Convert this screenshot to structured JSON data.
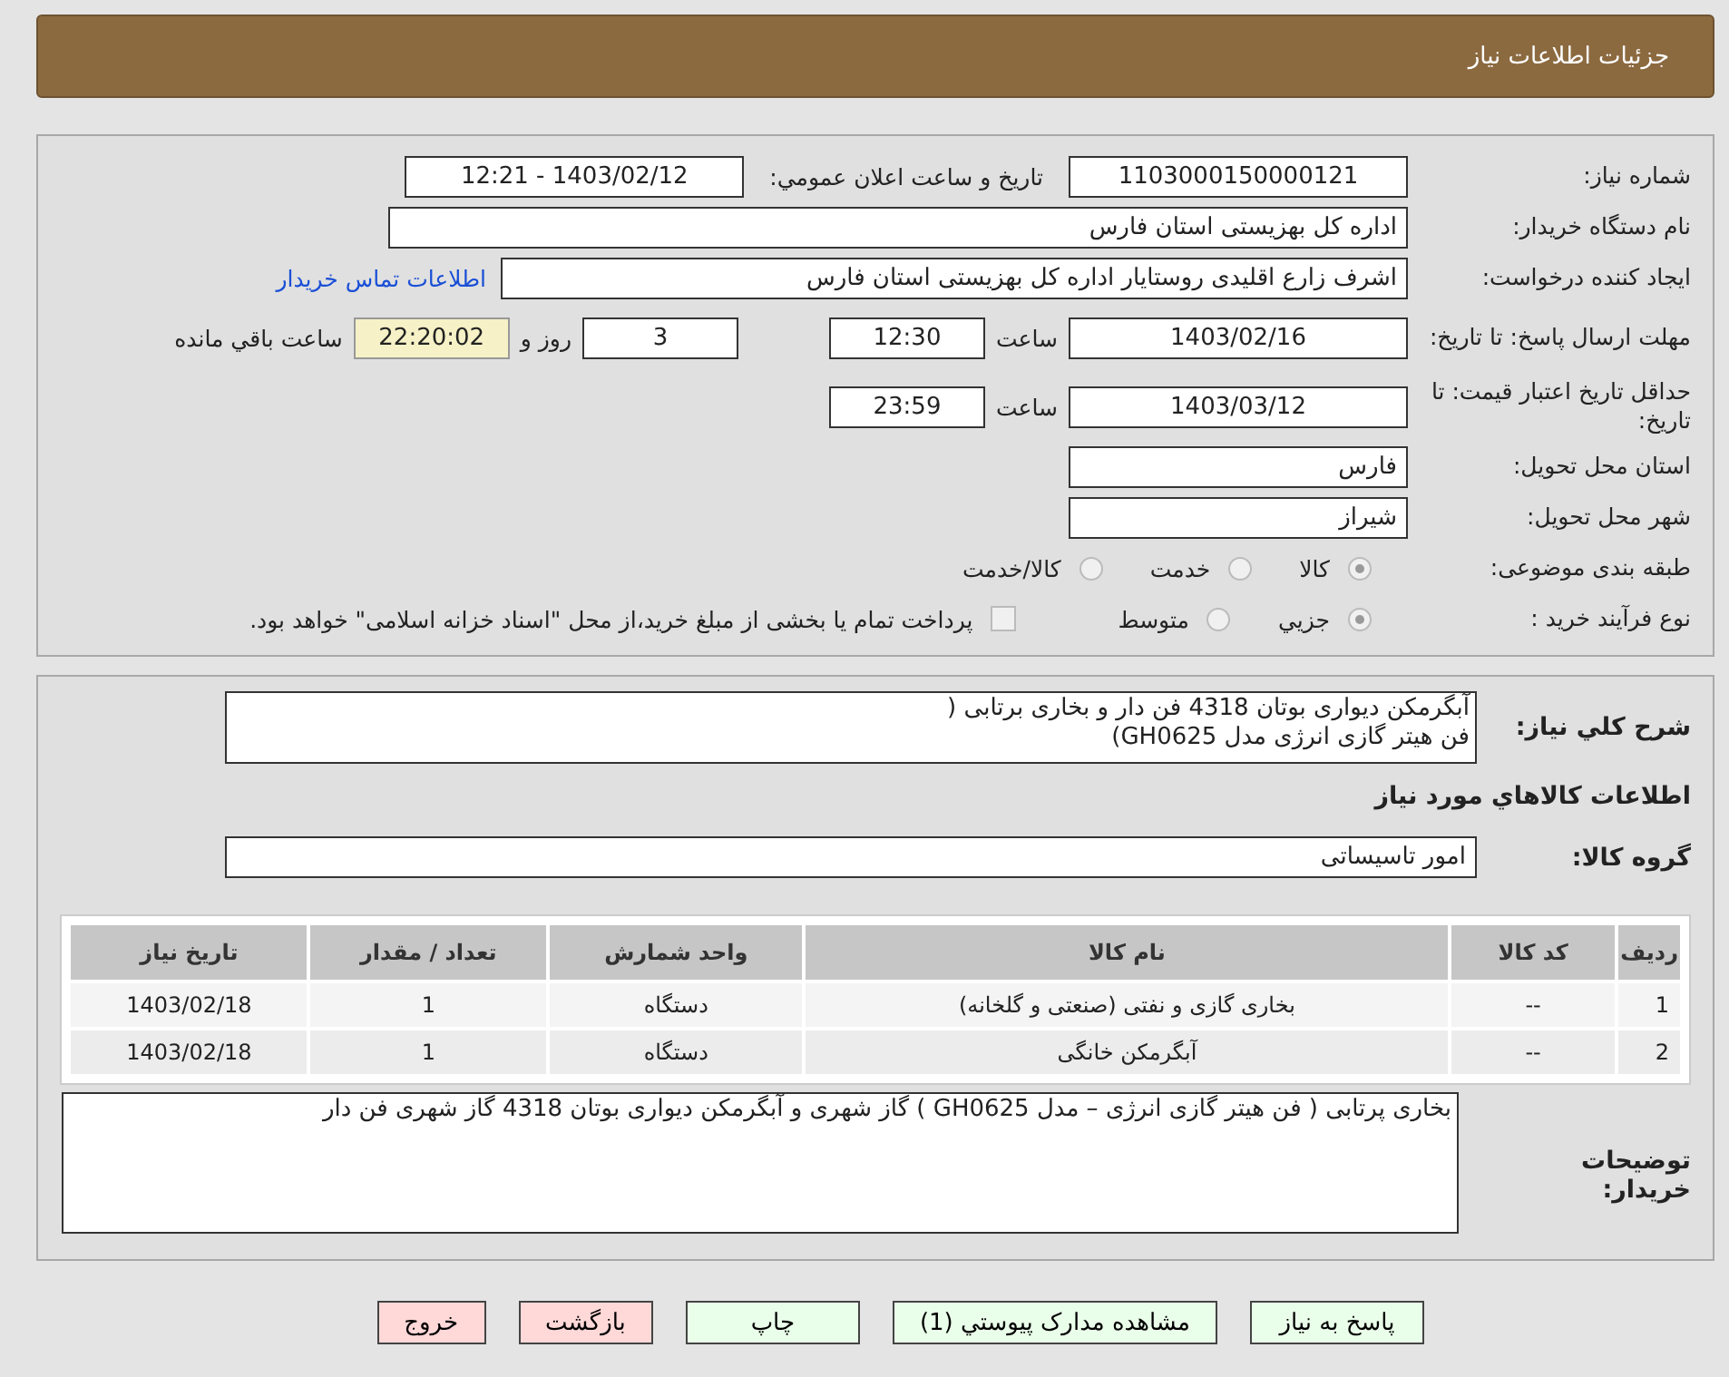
{
  "header": {
    "title": "جزئیات اطلاعات نیاز"
  },
  "details": {
    "need_number": {
      "label": "شماره نیاز:",
      "value": "1103000150000121"
    },
    "announce": {
      "label": "تاریخ و ساعت اعلان عمومي:",
      "value": "1403/02/12 - 12:21"
    },
    "buyer_org": {
      "label": "نام دستگاه خریدار:",
      "value": "اداره کل بهزیستی استان فارس"
    },
    "creator": {
      "label": "ایجاد کننده درخواست:",
      "value": "اشرف زارع اقلیدی روستایار اداره کل بهزیستی استان فارس",
      "link": "اطلاعات تماس خریدار"
    },
    "deadline": {
      "label": "مهلت ارسال پاسخ: تا تاریخ:",
      "date": "1403/02/16",
      "time_label": "ساعت",
      "time": "12:30",
      "days": "3",
      "days_label": "روز و",
      "remaining": "22:20:02",
      "remaining_label": "ساعت باقي مانده"
    },
    "validity": {
      "label": "حداقل تاریخ اعتبار قیمت: تا تاریخ:",
      "date": "1403/03/12",
      "time_label": "ساعت",
      "time": "23:59"
    },
    "province": {
      "label": "استان محل تحویل:",
      "value": "فارس"
    },
    "city": {
      "label": "شهر محل تحویل:",
      "value": "شیراز"
    },
    "category": {
      "label": "طبقه بندی موضوعی:",
      "options": [
        {
          "label": "کالا",
          "selected": true
        },
        {
          "label": "خدمت",
          "selected": false
        },
        {
          "label": "کالا/خدمت",
          "selected": false
        }
      ]
    },
    "process": {
      "label": "نوع فرآیند خرید :",
      "options": [
        {
          "label": "جزیي",
          "selected": true
        },
        {
          "label": "متوسط",
          "selected": false
        }
      ],
      "payment": {
        "label": "پرداخت تمام یا بخشی از مبلغ خرید،از محل \"اسناد خزانه اسلامی\" خواهد بود.",
        "checked": false
      }
    }
  },
  "needs": {
    "description": {
      "label": "شرح کلي نیاز:",
      "value": "آبگرمکن دیواری بوتان 4318 فن دار و بخاری برتابی (\nفن هیتر گازی انرژی مدل GH0625)"
    },
    "goods_heading": "اطلاعات کالاهاي مورد نیاز",
    "goods_group": {
      "label": "گروه کالا:",
      "value": "امور تاسیساتی"
    },
    "table": {
      "columns": [
        "ردیف",
        "کد کالا",
        "نام کالا",
        "واحد شمارش",
        "تعداد / مقدار",
        "تاریخ نیاز"
      ],
      "rows": [
        [
          "1",
          "--",
          "بخاری گازی و نفتی (صنعتی و گلخانه)",
          "دستگاه",
          "1",
          "1403/02/18"
        ],
        [
          "2",
          "--",
          "آبگرمکن خانگی",
          "دستگاه",
          "1",
          "1403/02/18"
        ]
      ]
    },
    "buyer_notes": {
      "label": "توضیحات خریدار:",
      "value": "بخاری پرتابی ( فن هیتر گازی انرژی – مدل GH0625 ) گاز شهری و آبگرمکن دیواری بوتان 4318 گاز شهری فن دار"
    }
  },
  "buttons": [
    {
      "label": "پاسخ به نیاز",
      "kind": "primary"
    },
    {
      "label": "مشاهده مدارک پیوستي (1)",
      "kind": "primary"
    },
    {
      "label": "چاپ",
      "kind": "primary"
    },
    {
      "label": "بازگشت",
      "kind": "danger"
    },
    {
      "label": "خروج",
      "kind": "danger"
    }
  ]
}
